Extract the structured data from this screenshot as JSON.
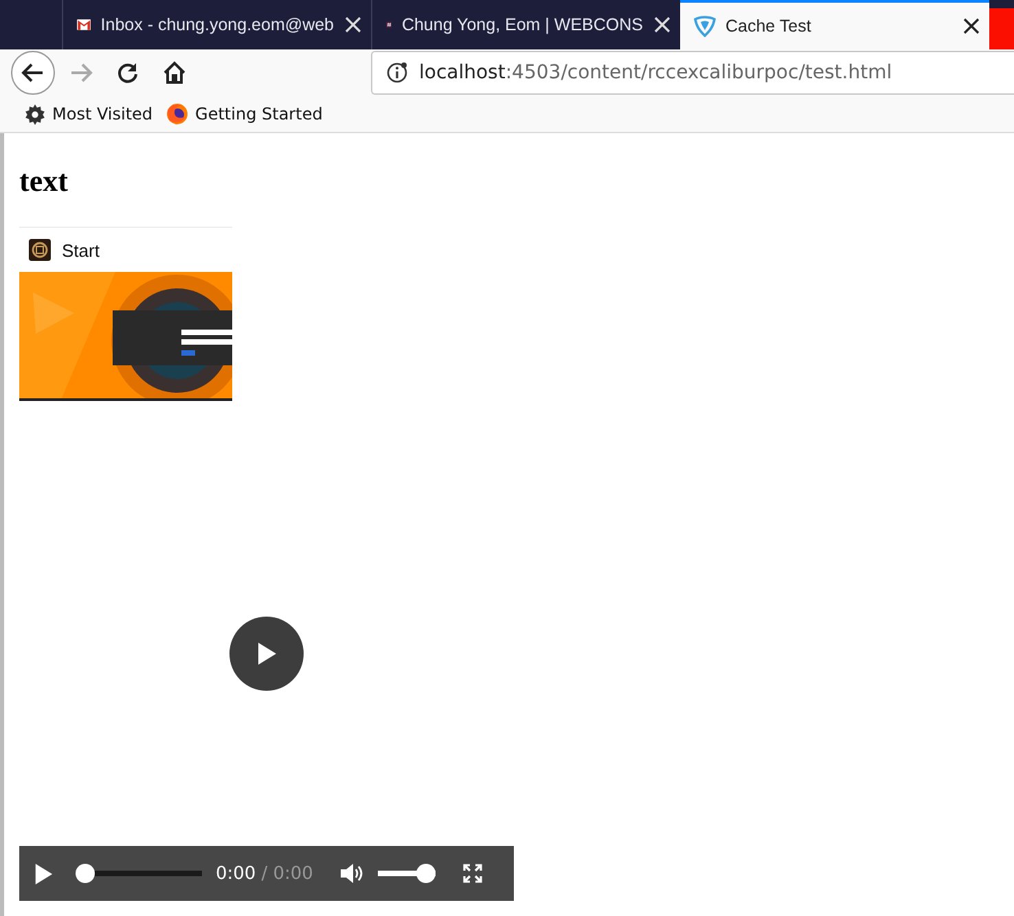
{
  "tabs": [
    {
      "kind": "mail",
      "title": "Inbox - chung.yong.eom@web",
      "selected": false
    },
    {
      "kind": "hash",
      "title": "Chung Yong, Eom | WEBCONS",
      "selected": false
    },
    {
      "kind": "shield",
      "title": "Cache Test",
      "selected": true
    }
  ],
  "nav": [
    {
      "kind": "back",
      "disabled": false
    },
    {
      "kind": "forward",
      "disabled": true
    },
    {
      "kind": "reload",
      "disabled": false
    },
    {
      "kind": "home",
      "disabled": false
    }
  ],
  "address": {
    "host": "localhost",
    "path": ":4503/content/rccexcaliburpoc/test.html"
  },
  "bookmarks": [
    {
      "kind": "gear",
      "label": "Most Visited"
    },
    {
      "kind": "firefox",
      "label": "Getting Started"
    }
  ],
  "heading": "text",
  "video": {
    "poster_title": "Start",
    "playing": false,
    "time": "0:00",
    "duration": "/ 0:00",
    "progress": {
      "level": 0
    },
    "volume": {
      "level": 1
    }
  }
}
